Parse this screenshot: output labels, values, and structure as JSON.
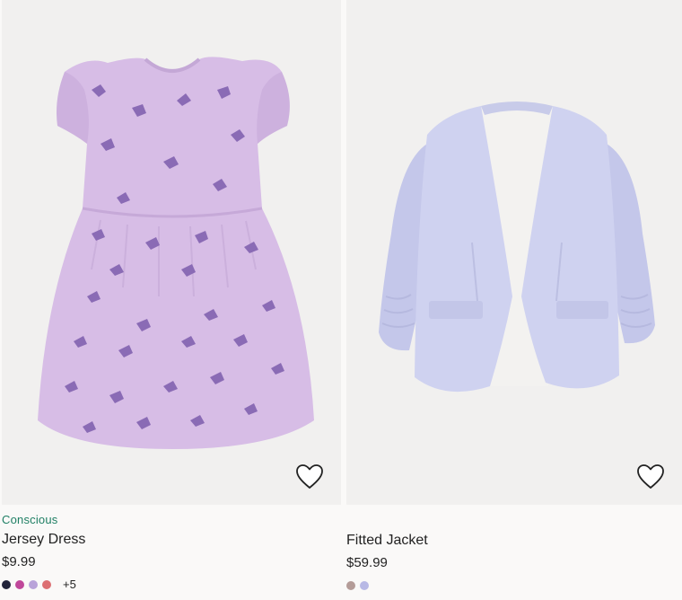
{
  "products": [
    {
      "tag": "Conscious",
      "name": "Jersey Dress",
      "price": "$9.99",
      "swatches": [
        "#22243a",
        "#c0479a",
        "#b9a3d9",
        "#dc6f72"
      ],
      "more_colors": "+5",
      "image": "purple-unicorn-print-dress",
      "colors": {
        "garment": "#d7bde6",
        "print": "#8a6bb5"
      }
    },
    {
      "tag": "",
      "name": "Fitted Jacket",
      "price": "$59.99",
      "swatches": [
        "#b49c98",
        "#b8b9e5"
      ],
      "more_colors": "",
      "image": "lavender-fitted-blazer",
      "colors": {
        "garment": "#cfd2f0",
        "lining": "#f3f2f0"
      }
    }
  ],
  "colors": {
    "tag_green": "#1f7f64",
    "image_bg": "#f1f0ef",
    "page_bg": "#faf9f8"
  },
  "icons": {
    "favorite": "heart-outline-icon"
  }
}
